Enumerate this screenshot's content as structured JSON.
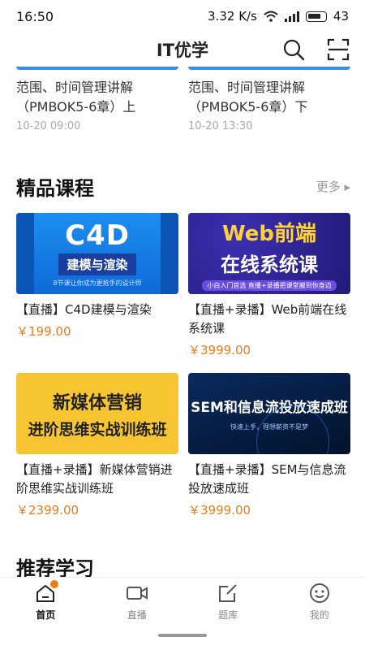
{
  "status_bar": {
    "time": "16:50",
    "network_speed": "3.32 K/s",
    "battery": "43"
  },
  "app_bar": {
    "title": "IT优学"
  },
  "previous_items": [
    {
      "title": "范围、时间管理讲解（PMBOK5-6章）上",
      "time": "10-20 09:00"
    },
    {
      "title": "范围、时间管理讲解（PMBOK5-6章）下",
      "time": "10-20 13:30"
    }
  ],
  "featured": {
    "title": "精品课程",
    "more_label": "更多 ▸",
    "courses": [
      {
        "title": "【直播】C4D建模与渲染",
        "price": "￥199.00",
        "thumb_big": "C4D",
        "thumb_mid": "建模与渲染",
        "thumb_small": "8节课让你成为更抢手的设计师"
      },
      {
        "title": "【直播+录播】Web前端在线系统课",
        "price": "￥3999.00",
        "thumb_big": "Web前端",
        "thumb_mid": "在线系统课",
        "thumb_small": "小白入门首选 直播+录播把课堂搬到你身边"
      },
      {
        "title": "【直播+录播】新媒体营销进阶思维实战训练班",
        "price": "￥2399.00",
        "thumb_big": "新媒体营销",
        "thumb_mid": "进阶思维实战训练班"
      },
      {
        "title": "【直播+录播】SEM与信息流投放速成班",
        "price": "￥3999.00",
        "thumb_big": "SEM和信息流投放速成班",
        "thumb_small": "快速上手，理想薪资不是梦"
      }
    ]
  },
  "recommend": {
    "title": "推荐学习"
  },
  "tabbar": {
    "items": [
      {
        "label": "首页",
        "icon": "home-icon"
      },
      {
        "label": "直播",
        "icon": "video-icon"
      },
      {
        "label": "题库",
        "icon": "edit-icon"
      },
      {
        "label": "我的",
        "icon": "profile-icon"
      }
    ]
  },
  "colors": {
    "price": "#f07a1a",
    "accent": "#3a8ee6"
  }
}
